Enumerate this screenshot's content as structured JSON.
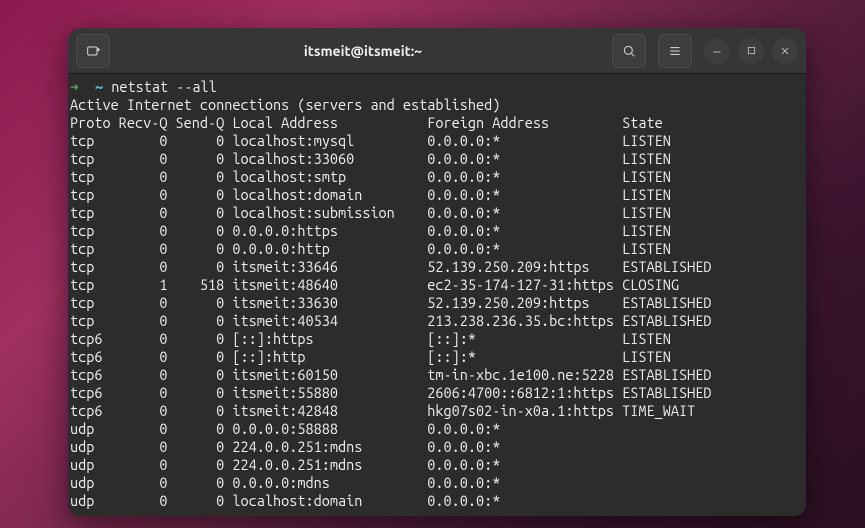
{
  "window": {
    "title": "itsmeit@itsmeit:~"
  },
  "prompt": {
    "arrow": "➜",
    "cwd": "~",
    "command": "netstat --all"
  },
  "output": {
    "header": "Active Internet connections (servers and established)",
    "columns_line": "Proto Recv-Q Send-Q Local Address           Foreign Address         State",
    "rows": [
      "tcp        0      0 localhost:mysql         0.0.0.0:*               LISTEN",
      "tcp        0      0 localhost:33060         0.0.0.0:*               LISTEN",
      "tcp        0      0 localhost:smtp          0.0.0.0:*               LISTEN",
      "tcp        0      0 localhost:domain        0.0.0.0:*               LISTEN",
      "tcp        0      0 localhost:submission    0.0.0.0:*               LISTEN",
      "tcp        0      0 0.0.0.0:https           0.0.0.0:*               LISTEN",
      "tcp        0      0 0.0.0.0:http            0.0.0.0:*               LISTEN",
      "tcp        0      0 itsmeit:33646           52.139.250.209:https    ESTABLISHED",
      "tcp        1    518 itsmeit:48640           ec2-35-174-127-31:https CLOSING",
      "tcp        0      0 itsmeit:33630           52.139.250.209:https    ESTABLISHED",
      "tcp        0      0 itsmeit:40534           213.238.236.35.bc:https ESTABLISHED",
      "tcp6       0      0 [::]:https              [::]:*                  LISTEN",
      "tcp6       0      0 [::]:http               [::]:*                  LISTEN",
      "tcp6       0      0 itsmeit:60150           tm-in-xbc.1e100.ne:5228 ESTABLISHED",
      "tcp6       0      0 itsmeit:55880           2606:4700::6812:1:https ESTABLISHED",
      "tcp6       0      0 itsmeit:42848           hkg07s02-in-x0a.1:https TIME_WAIT",
      "udp        0      0 0.0.0.0:58888           0.0.0.0:*",
      "udp        0      0 224.0.0.251:mdns        0.0.0.0:*",
      "udp        0      0 224.0.0.251:mdns        0.0.0.0:*",
      "udp        0      0 0.0.0.0:mdns            0.0.0.0:*",
      "udp        0      0 localhost:domain        0.0.0.0:*"
    ]
  }
}
